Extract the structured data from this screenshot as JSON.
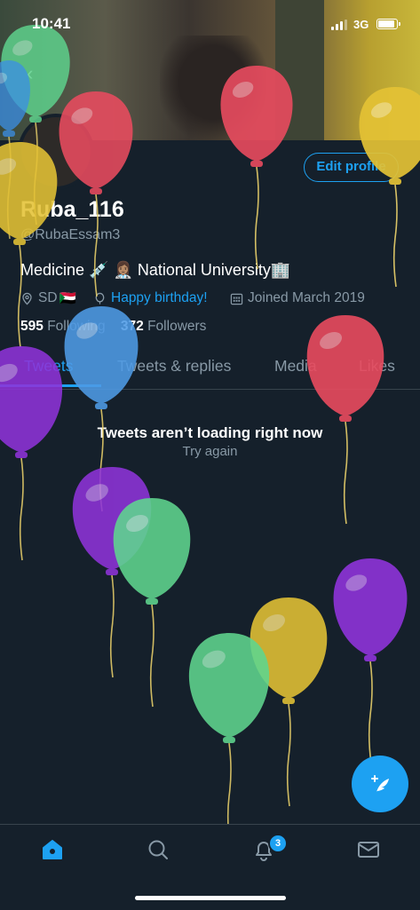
{
  "status_bar": {
    "time": "10:41",
    "network": "3G"
  },
  "profile": {
    "name": "Ruba_116",
    "handle": "@RubaEssam3",
    "bio": "Medicine 💉 👩🏽‍⚕️ National University🏢",
    "location": "SD",
    "location_flag": "🇸🇩",
    "birthday": "Happy birthday!",
    "joined": "Joined March 2019",
    "following_count": "595",
    "following_label": "Following",
    "followers_count": "372",
    "followers_label": "Followers",
    "edit_button": "Edit profile"
  },
  "tabs": [
    {
      "label": "Tweets",
      "active": true
    },
    {
      "label": "Tweets & replies",
      "active": false
    },
    {
      "label": "Media",
      "active": false
    },
    {
      "label": "Likes",
      "active": false
    }
  ],
  "error": {
    "title": "Tweets aren’t loading right now",
    "retry": "Try again"
  },
  "nav": {
    "notifications_badge": "3"
  },
  "colors": {
    "accent": "#1da1f2",
    "background": "#15202b",
    "muted": "#8899a6"
  },
  "icons": [
    "back-arrow-icon",
    "location-icon",
    "balloon-icon",
    "calendar-icon",
    "compose-tweet-icon",
    "home-icon",
    "search-icon",
    "notifications-icon",
    "messages-icon"
  ]
}
